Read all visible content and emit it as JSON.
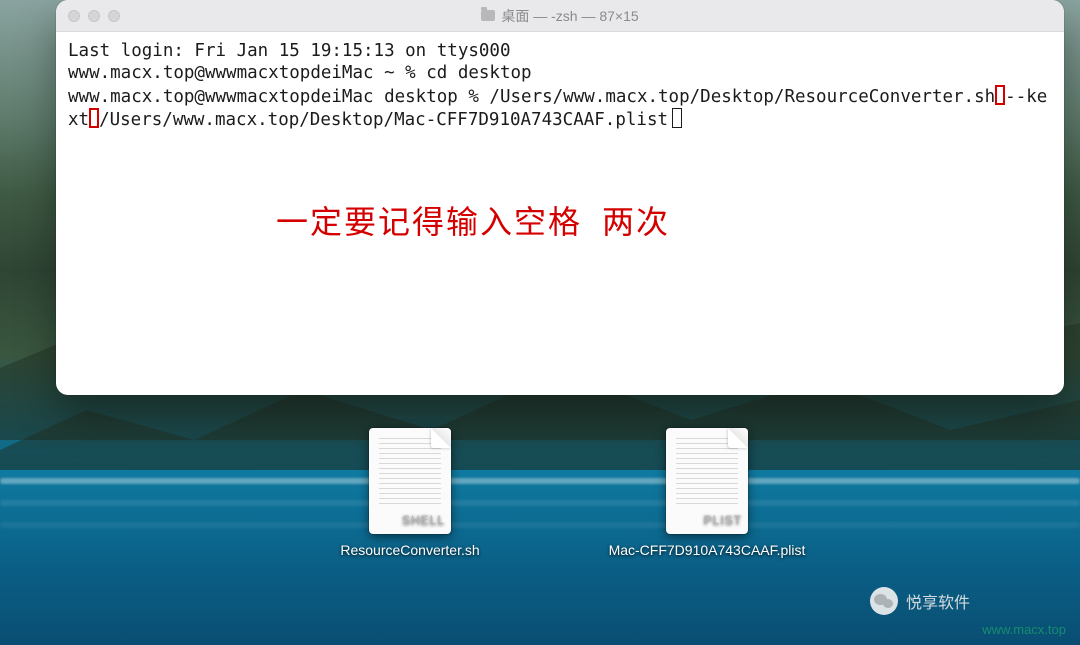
{
  "terminal": {
    "title": "桌面 — -zsh — 87×15",
    "line_lastlogin": "Last login: Fri Jan 15 19:15:13 on ttys000",
    "line_prompt1": "www.macx.top@wwwmacxtopdeiMac ~ % cd desktop",
    "line2_prefix": "www.macx.top@wwwmacxtopdeiMac desktop % /Users/www.macx.top/Desktop/ResourceConverter.sh",
    "line2_mid": "--kext",
    "line2_suffix": "/Users/www.macx.top/Desktop/Mac-CFF7D910A743CAAF.plist",
    "annotation": "一定要记得输入空格  两次"
  },
  "desktop_files": {
    "file1_tag": "SHELL",
    "file1_name": "ResourceConverter.sh",
    "file2_tag": "PLIST",
    "file2_name": "Mac-CFF7D910A743CAAF.plist"
  },
  "watermark": {
    "wechat_label": "悦享软件",
    "site": "www.macx.top"
  }
}
